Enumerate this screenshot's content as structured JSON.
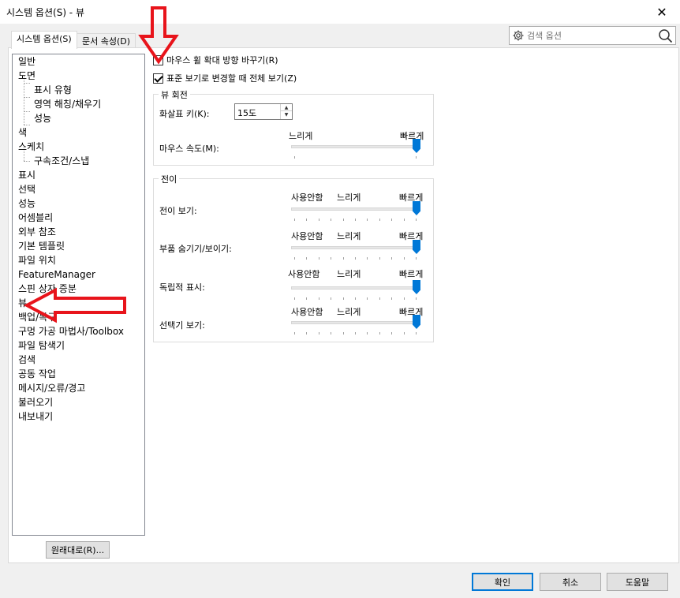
{
  "window": {
    "title": "시스템 옵션(S) - 뷰",
    "close_glyph": "✕"
  },
  "tabs": [
    {
      "label": "시스템 옵션(S)"
    },
    {
      "label": "문서 속성(D)"
    }
  ],
  "search": {
    "placeholder": "검색 옵션",
    "icon_left": "gear-icon",
    "icon_right": "search-icon"
  },
  "tree": {
    "items": [
      {
        "label": "일반"
      },
      {
        "label": "도면"
      },
      {
        "label": "표시 유형"
      },
      {
        "label": "영역 해칭/채우기"
      },
      {
        "label": "성능"
      },
      {
        "label": "색"
      },
      {
        "label": "스케치"
      },
      {
        "label": "구속조건/스냅"
      },
      {
        "label": "표시"
      },
      {
        "label": "선택"
      },
      {
        "label": "성능"
      },
      {
        "label": "어셈블리"
      },
      {
        "label": "외부 참조"
      },
      {
        "label": "기본 템플릿"
      },
      {
        "label": "파일 위치"
      },
      {
        "label": "FeatureManager"
      },
      {
        "label": "스핀 상자 증분"
      },
      {
        "label": "뷰"
      },
      {
        "label": "백업/복구"
      },
      {
        "label": "구멍 가공 마법사/Toolbox"
      },
      {
        "label": "파일 탐색기"
      },
      {
        "label": "검색"
      },
      {
        "label": "공동 작업"
      },
      {
        "label": "메시지/오류/경고"
      },
      {
        "label": "불러오기"
      },
      {
        "label": "내보내기"
      }
    ],
    "selected": "뷰"
  },
  "reset_button": "원래대로(R)...",
  "options": {
    "reverse_wheel": {
      "label": "마우스 휠 확대 방향 바꾸기(R)",
      "checked": false
    },
    "zoom_to_fit": {
      "label": "표준 보기로 변경할 때 전체 보기(Z)",
      "checked": true
    }
  },
  "view_rotation": {
    "title": "뷰 회전",
    "arrow_keys_label": "화살표 키(K):",
    "arrow_keys_value": "15도",
    "mouse_speed_label": "마우스 속도(M):",
    "slow": "느리게",
    "fast": "빠르게",
    "mouse_speed_level": 1.0
  },
  "transitions": {
    "title": "전이",
    "off": "사용안함",
    "slow": "느리게",
    "fast": "빠르게",
    "rows": [
      {
        "label": "전이 보기:",
        "level": 1.0
      },
      {
        "label": "부품 숨기기/보이기:",
        "level": 1.0
      },
      {
        "label": "독립적 표시:",
        "level": 1.0
      },
      {
        "label": "선택기 보기:",
        "level": 1.0
      }
    ]
  },
  "footer": {
    "ok": "확인",
    "cancel": "취소",
    "help": "도움말"
  },
  "colors": {
    "accent": "#0078d7",
    "annotation_arrow": "#e8141b"
  }
}
